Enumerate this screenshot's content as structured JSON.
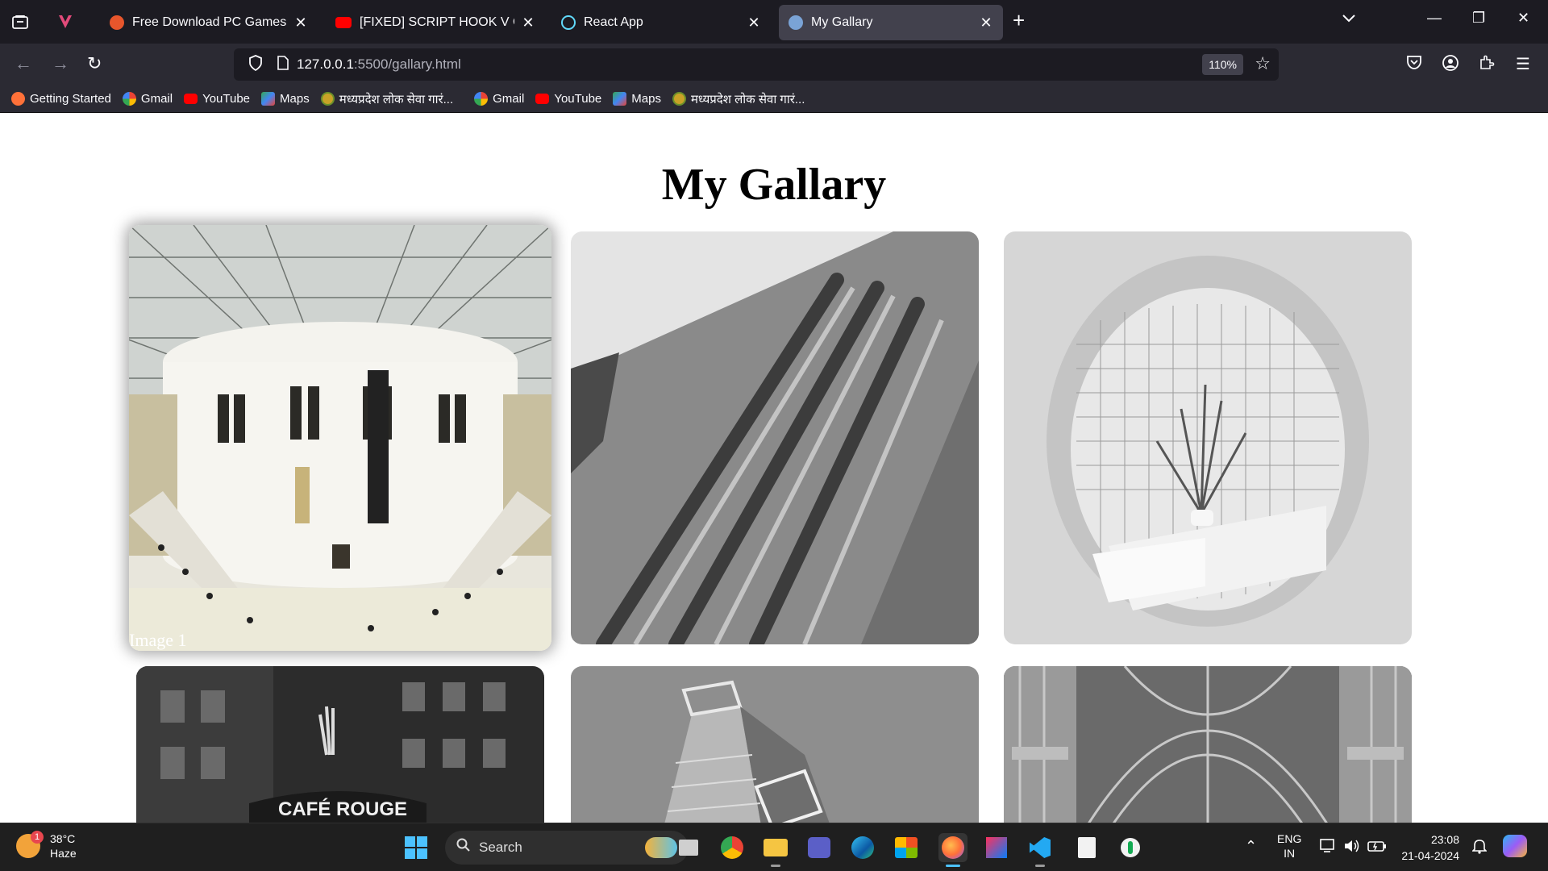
{
  "browser": {
    "tabs": [
      {
        "title": "Free Download PC Games - Ap",
        "active": false
      },
      {
        "title": "[FIXED] SCRIPT HOOK V CRITIC",
        "active": false
      },
      {
        "title": "React App",
        "active": false
      },
      {
        "title": "My Gallary",
        "active": true
      }
    ],
    "url_host": "127.0.0.1",
    "url_path": ":5500/gallary.html",
    "zoom": "110%",
    "bookmarks": [
      {
        "label": "Getting Started",
        "icon": "firefox-icon"
      },
      {
        "label": "Gmail",
        "icon": "google-icon"
      },
      {
        "label": "YouTube",
        "icon": "youtube-icon"
      },
      {
        "label": "Maps",
        "icon": "maps-icon"
      },
      {
        "label": "मध्यप्रदेश लोक सेवा गारं...",
        "icon": "mp-seal-icon"
      },
      {
        "label": "Gmail",
        "icon": "google-icon"
      },
      {
        "label": "YouTube",
        "icon": "youtube-icon"
      },
      {
        "label": "Maps",
        "icon": "maps-icon"
      },
      {
        "label": "मध्यप्रदेश लोक सेवा गारं...",
        "icon": "mp-seal-icon"
      }
    ]
  },
  "page": {
    "title": "My Gallary",
    "images": [
      {
        "caption": "Image 1",
        "subject": "british-museum-great-court",
        "hovered": true
      },
      {
        "subject": "cathedral-facade-columns"
      },
      {
        "subject": "tiled-room-palm-plant"
      },
      {
        "subject": "cafe-rouge-building",
        "sign": "CAFÉ ROUGE"
      },
      {
        "subject": "modern-glass-building"
      },
      {
        "subject": "gothic-vaulted-arches"
      }
    ]
  },
  "taskbar": {
    "weather": {
      "temp": "38°C",
      "condition": "Haze",
      "badge": "1"
    },
    "search_placeholder": "Search",
    "lang_line1": "ENG",
    "lang_line2": "IN",
    "time": "23:08",
    "date": "21-04-2024"
  },
  "colors": {
    "chrome_dark": "#1c1b22",
    "chrome_mid": "#2b2a33",
    "accent": "#4cc2ff"
  }
}
